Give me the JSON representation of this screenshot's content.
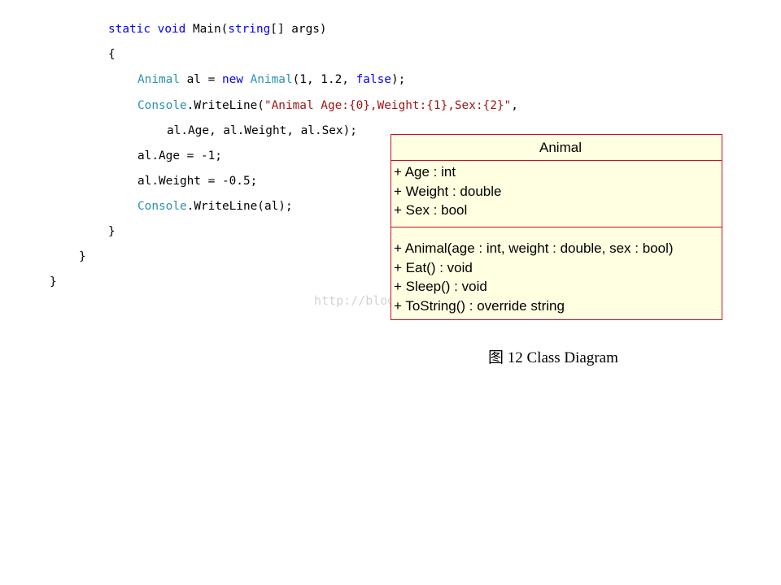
{
  "code": {
    "l1": {
      "kw1": "static",
      "sp1": " ",
      "kw2": "void",
      "rest": " Main(",
      "kw3": "string",
      "tail": "[] args)"
    },
    "l2": "{",
    "l3": {
      "t1": "Animal",
      "mid": " al = ",
      "kw": "new",
      "sp": " ",
      "t2": "Animal",
      "args": "(1, 1.2, ",
      "kw2": "false",
      "end": ");"
    },
    "l4": {
      "t": "Console",
      "call": ".WriteLine(",
      "str": "\"Animal Age:{0},Weight:{1},Sex:{2}\"",
      "end": ","
    },
    "l5": "al.Age, al.Weight, al.Sex);",
    "l6": "al.Age = -1;",
    "l7": "al.Weight = -0.5;",
    "l8": {
      "t": "Console",
      "call": ".WriteLine(al);"
    },
    "l9": "}",
    "l10": "}",
    "l11": "}"
  },
  "watermark": "http://blog.",
  "uml": {
    "class_name": "Animal",
    "attributes": [
      "+ Age : int",
      "+ Weight : double",
      "+ Sex : bool"
    ],
    "operations": [
      "+ Animal(age : int, weight : double, sex : bool)",
      "+ Eat() : void",
      "+ Sleep() : void",
      "+ ToString() : override string"
    ]
  },
  "caption": "图 12 Class Diagram",
  "colors": {
    "keyword": "#0000ff",
    "type": "#2b91af",
    "string": "#a31515",
    "uml_fill": "#ffffe1",
    "uml_border": "#c8102e"
  }
}
